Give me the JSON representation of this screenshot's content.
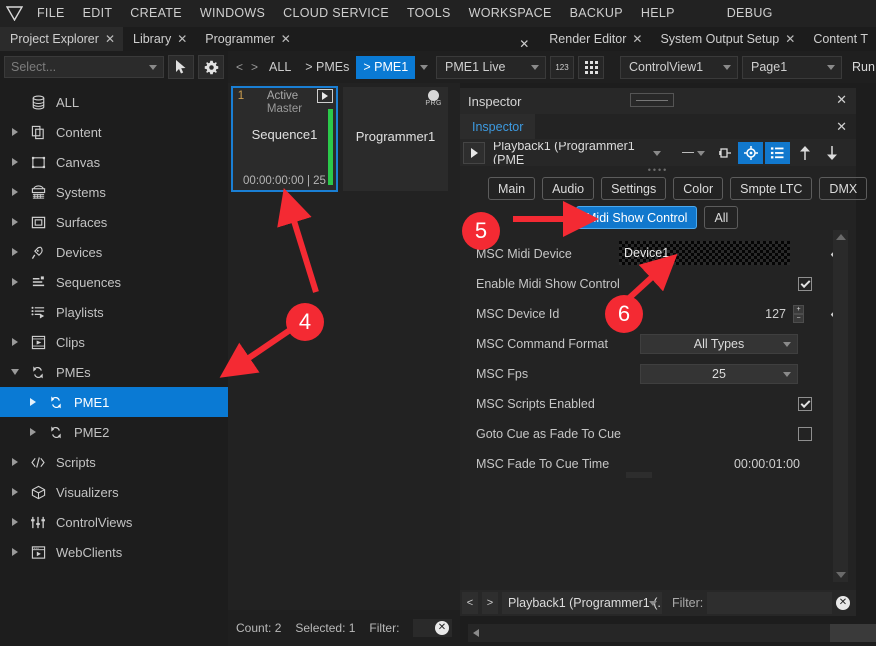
{
  "menu": {
    "logo": "triangle-logo",
    "items": [
      "FILE",
      "EDIT",
      "CREATE",
      "WINDOWS",
      "CLOUD SERVICE",
      "TOOLS",
      "WORKSPACE",
      "BACKUP",
      "HELP"
    ],
    "debug": "DEBUG"
  },
  "tabs": {
    "left": [
      {
        "label": "Project Explorer",
        "close": "✕",
        "active": true
      },
      {
        "label": "Library",
        "close": "✕",
        "active": false
      },
      {
        "label": "Programmer",
        "close": "✕",
        "active": false
      }
    ],
    "mid_close": "✕",
    "right": [
      {
        "label": "Render Editor",
        "close": "✕"
      },
      {
        "label": "System Output Setup",
        "close": "✕"
      },
      {
        "label": "Content T",
        "close": ""
      }
    ]
  },
  "explorer": {
    "select_placeholder": "Select...",
    "pointer_icon": "cursor-arrow-icon",
    "gear_icon": "gear-icon",
    "tree": [
      {
        "label": "ALL",
        "icon": "database-icon",
        "arrow": "none",
        "indent": 0,
        "selected": false
      },
      {
        "label": "Content",
        "icon": "copy-icon",
        "arrow": "right",
        "indent": 0,
        "selected": false
      },
      {
        "label": "Canvas",
        "icon": "canvas-icon",
        "arrow": "right",
        "indent": 0,
        "selected": false
      },
      {
        "label": "Systems",
        "icon": "server-icon",
        "arrow": "right",
        "indent": 0,
        "selected": false
      },
      {
        "label": "Surfaces",
        "icon": "surface-icon",
        "arrow": "right",
        "indent": 0,
        "selected": false
      },
      {
        "label": "Devices",
        "icon": "plug-icon",
        "arrow": "right",
        "indent": 0,
        "selected": false
      },
      {
        "label": "Sequences",
        "icon": "sequence-icon",
        "arrow": "right",
        "indent": 0,
        "selected": false
      },
      {
        "label": "Playlists",
        "icon": "playlist-icon",
        "arrow": "none",
        "indent": 0,
        "selected": false
      },
      {
        "label": "Clips",
        "icon": "clip-icon",
        "arrow": "right",
        "indent": 0,
        "selected": false
      },
      {
        "label": "PMEs",
        "icon": "pme-icon",
        "arrow": "down",
        "indent": 0,
        "selected": false
      },
      {
        "label": "PME1",
        "icon": "pme-icon",
        "arrow": "right",
        "indent": 1,
        "selected": true
      },
      {
        "label": "PME2",
        "icon": "pme-icon",
        "arrow": "right",
        "indent": 1,
        "selected": false
      },
      {
        "label": "Scripts",
        "icon": "code-icon",
        "arrow": "right",
        "indent": 0,
        "selected": false
      },
      {
        "label": "Visualizers",
        "icon": "cube-icon",
        "arrow": "right",
        "indent": 0,
        "selected": false
      },
      {
        "label": "ControlViews",
        "icon": "faders-icon",
        "arrow": "right",
        "indent": 0,
        "selected": false
      },
      {
        "label": "WebClients",
        "icon": "webclient-icon",
        "arrow": "right",
        "indent": 0,
        "selected": false
      }
    ]
  },
  "center": {
    "breadcrumb": {
      "prev": "<",
      "next": ">",
      "root": "ALL",
      "level1": "> PMEs",
      "level2": "> PME1"
    },
    "executor": {
      "number": "1",
      "state": "Active",
      "play_icon": "play-icon",
      "master": "Master",
      "name": "Sequence1",
      "time": "00:00:00:00 | 25",
      "bar_color": "#2bc94a"
    },
    "programmer": {
      "name": "Programmer1",
      "badge": "PRG",
      "badge_icon": "prg-dot-icon"
    },
    "status": {
      "count_label": "Count: 2",
      "selected_label": "Selected: 1",
      "filter_label": "Filter:",
      "clear_icon": "clear-icon"
    }
  },
  "topbar": {
    "live_combo": "PME1 Live",
    "num_btn": "123",
    "grid_icon": "grid-icon",
    "controlview_combo": "ControlView1",
    "page_combo": "Page1",
    "run_label": "Run"
  },
  "inspector": {
    "window_title": "Inspector",
    "close_icon": "✕",
    "tab_label": "Inspector",
    "object_combo": "Playback1 (Programmer1 (PME",
    "toolbar_icons": [
      "play-icon",
      "dash-dropdown",
      "pin-icon",
      "target-icon",
      "list-icon",
      "arrow-up-icon",
      "arrow-down-icon"
    ],
    "category_tabs": [
      "Main",
      "Audio",
      "Settings",
      "Color",
      "Smpte LTC",
      "DMX"
    ],
    "subtabs": [
      {
        "label": "Midi Show Control",
        "active": true
      },
      {
        "label": "All",
        "active": false
      }
    ],
    "properties": [
      {
        "name": "MSC Midi Device",
        "type": "checkered-text",
        "value": "Device1",
        "revert": true
      },
      {
        "name": "Enable Midi Show Control",
        "type": "checkbox",
        "checked": true
      },
      {
        "name": "MSC Device Id",
        "type": "spinner",
        "value": "127",
        "revert": true
      },
      {
        "name": "MSC Command Format",
        "type": "dropdown",
        "value": "All Types"
      },
      {
        "name": "MSC Fps",
        "type": "dropdown",
        "value": "25"
      },
      {
        "name": "MSC Scripts Enabled",
        "type": "checkbox",
        "checked": true
      },
      {
        "name": "Goto Cue as Fade To Cue",
        "type": "checkbox",
        "checked": false
      },
      {
        "name": "MSC Fade To Cue Time",
        "type": "text",
        "value": "00:00:01:00"
      }
    ],
    "footer": {
      "prev": "<",
      "next": ">",
      "combo": "Playback1 (Programmer1 (...",
      "filter_label": "Filter:",
      "filter_value": "",
      "clear_icon": "clear-icon"
    }
  },
  "annotations": [
    {
      "id": "4",
      "label": "4"
    },
    {
      "id": "5",
      "label": "5"
    },
    {
      "id": "6",
      "label": "6"
    }
  ],
  "colors": {
    "accent_blue": "#0a7ad4",
    "annotation_red": "#f42a33",
    "executor_green": "#2bc94a",
    "tab_link_blue": "#3d9ae0"
  }
}
